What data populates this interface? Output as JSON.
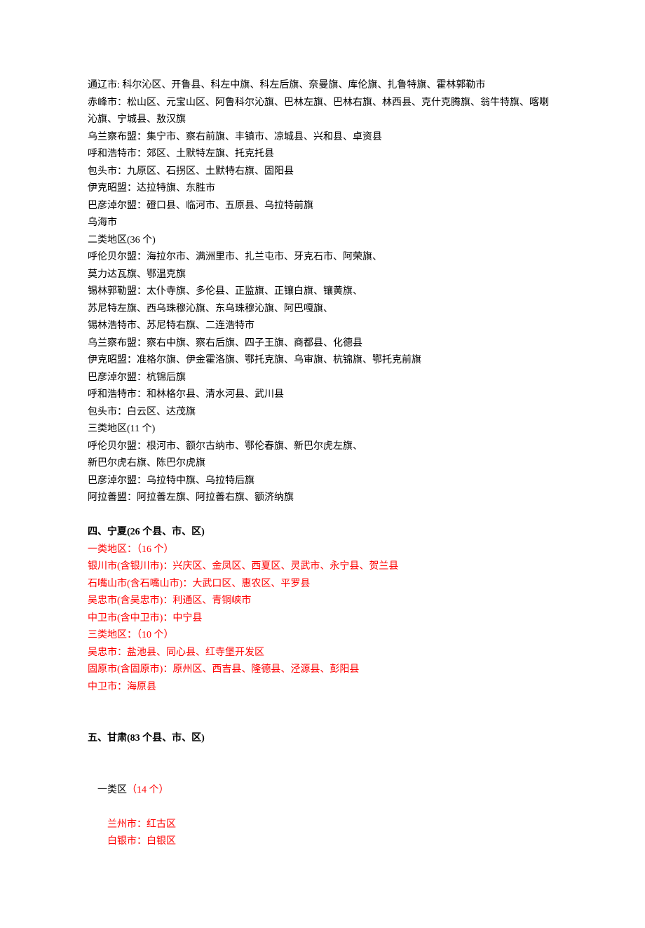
{
  "lines": [
    {
      "cls": "line",
      "text": "通辽市: 科尔沁区、开鲁县、科左中旗、科左后旗、奈曼旗、库伦旗、扎鲁特旗、霍林郭勒市"
    },
    {
      "cls": "line",
      "text": "赤峰市：松山区、元宝山区、阿鲁科尔沁旗、巴林左旗、巴林右旗、林西县、克什克腾旗、翁牛特旗、喀喇沁旗、宁城县、敖汉旗"
    },
    {
      "cls": "line",
      "text": "乌兰察布盟：集宁市、察右前旗、丰镇市、凉城县、兴和县、卓资县"
    },
    {
      "cls": "line",
      "text": "呼和浩特市：郊区、土默特左旗、托克托县"
    },
    {
      "cls": "line",
      "text": "包头市：九原区、石拐区、土默特右旗、固阳县"
    },
    {
      "cls": "line",
      "text": "伊克昭盟：达拉特旗、东胜市"
    },
    {
      "cls": "line",
      "text": "巴彦淖尔盟：磴口县、临河市、五原县、乌拉特前旗"
    },
    {
      "cls": "line",
      "text": "乌海市"
    },
    {
      "cls": "line",
      "text": "二类地区(36 个)"
    },
    {
      "cls": "line",
      "text": "呼伦贝尔盟：海拉尔市、满洲里市、扎兰屯市、牙克石市、阿荣旗、"
    },
    {
      "cls": "line",
      "text": "莫力达瓦旗、鄂温克旗"
    },
    {
      "cls": "line",
      "text": "锡林郭勒盟：太仆寺旗、多伦县、正监旗、正镶白旗、镶黄旗、"
    },
    {
      "cls": "line",
      "text": "苏尼特左旗、西乌珠穆沁旗、东乌珠穆沁旗、阿巴嘎旗、"
    },
    {
      "cls": "line",
      "text": "锡林浩特市、苏尼特右旗、二连浩特市"
    },
    {
      "cls": "line",
      "text": "乌兰察布盟：察右中旗、察右后旗、四子王旗、商都县、化德县"
    },
    {
      "cls": "line",
      "text": "伊克昭盟：准格尔旗、伊金霍洛旗、鄂托克旗、乌审旗、杭锦旗、鄂托克前旗"
    },
    {
      "cls": "line",
      "text": "巴彦淖尔盟：杭锦后旗"
    },
    {
      "cls": "line",
      "text": "呼和浩特市：和林格尔县、清水河县、武川县"
    },
    {
      "cls": "line",
      "text": "包头市：白云区、达茂旗"
    },
    {
      "cls": "line",
      "text": "三类地区(11 个)"
    },
    {
      "cls": "line",
      "text": "呼伦贝尔盟：根河市、额尔古纳市、鄂伦春旗、新巴尔虎左旗、"
    },
    {
      "cls": "line",
      "text": "新巴尔虎右旗、陈巴尔虎旗"
    },
    {
      "cls": "line",
      "text": "巴彦淖尔盟：乌拉特中旗、乌拉特后旗"
    },
    {
      "cls": "line",
      "text": "阿拉善盟：阿拉善左旗、阿拉善右旗、额济纳旗"
    },
    {
      "cls": "spacer",
      "text": ""
    },
    {
      "cls": "bold",
      "text": "四、宁夏(26 个县、市、区)"
    },
    {
      "cls": "red",
      "text": "一类地区：（16 个）"
    },
    {
      "cls": "red",
      "text": "银川市(含银川市)：兴庆区、金凤区、西夏区、灵武市、永宁县、贺兰县"
    },
    {
      "cls": "red",
      "text": "石嘴山市(含石嘴山市)：大武口区、惠农区、平罗县"
    },
    {
      "cls": "red",
      "text": "吴忠市(含吴忠市)：利通区、青铜峡市"
    },
    {
      "cls": "red",
      "text": "中卫市(含中卫市)：中宁县"
    },
    {
      "cls": "red",
      "text": "三类地区：（10 个）"
    },
    {
      "cls": "red",
      "text": "吴忠市：盐池县、同心县、红寺堡开发区"
    },
    {
      "cls": "red",
      "text": "固原市(含固原市)：原州区、西吉县、隆德县、泾源县、彭阳县"
    },
    {
      "cls": "red",
      "text": "中卫市：海原县"
    },
    {
      "cls": "spacer",
      "text": ""
    },
    {
      "cls": "spacer",
      "text": ""
    },
    {
      "cls": "bold",
      "text": "五、甘肃(83 个县、市、区)"
    },
    {
      "cls": "spacer",
      "text": ""
    }
  ],
  "gansu_category1_label_prefix": "一类区",
  "gansu_category1_label_suffix": "（14 个）",
  "gansu_items": [
    "兰州市：红古区",
    "白银市：白银区"
  ]
}
